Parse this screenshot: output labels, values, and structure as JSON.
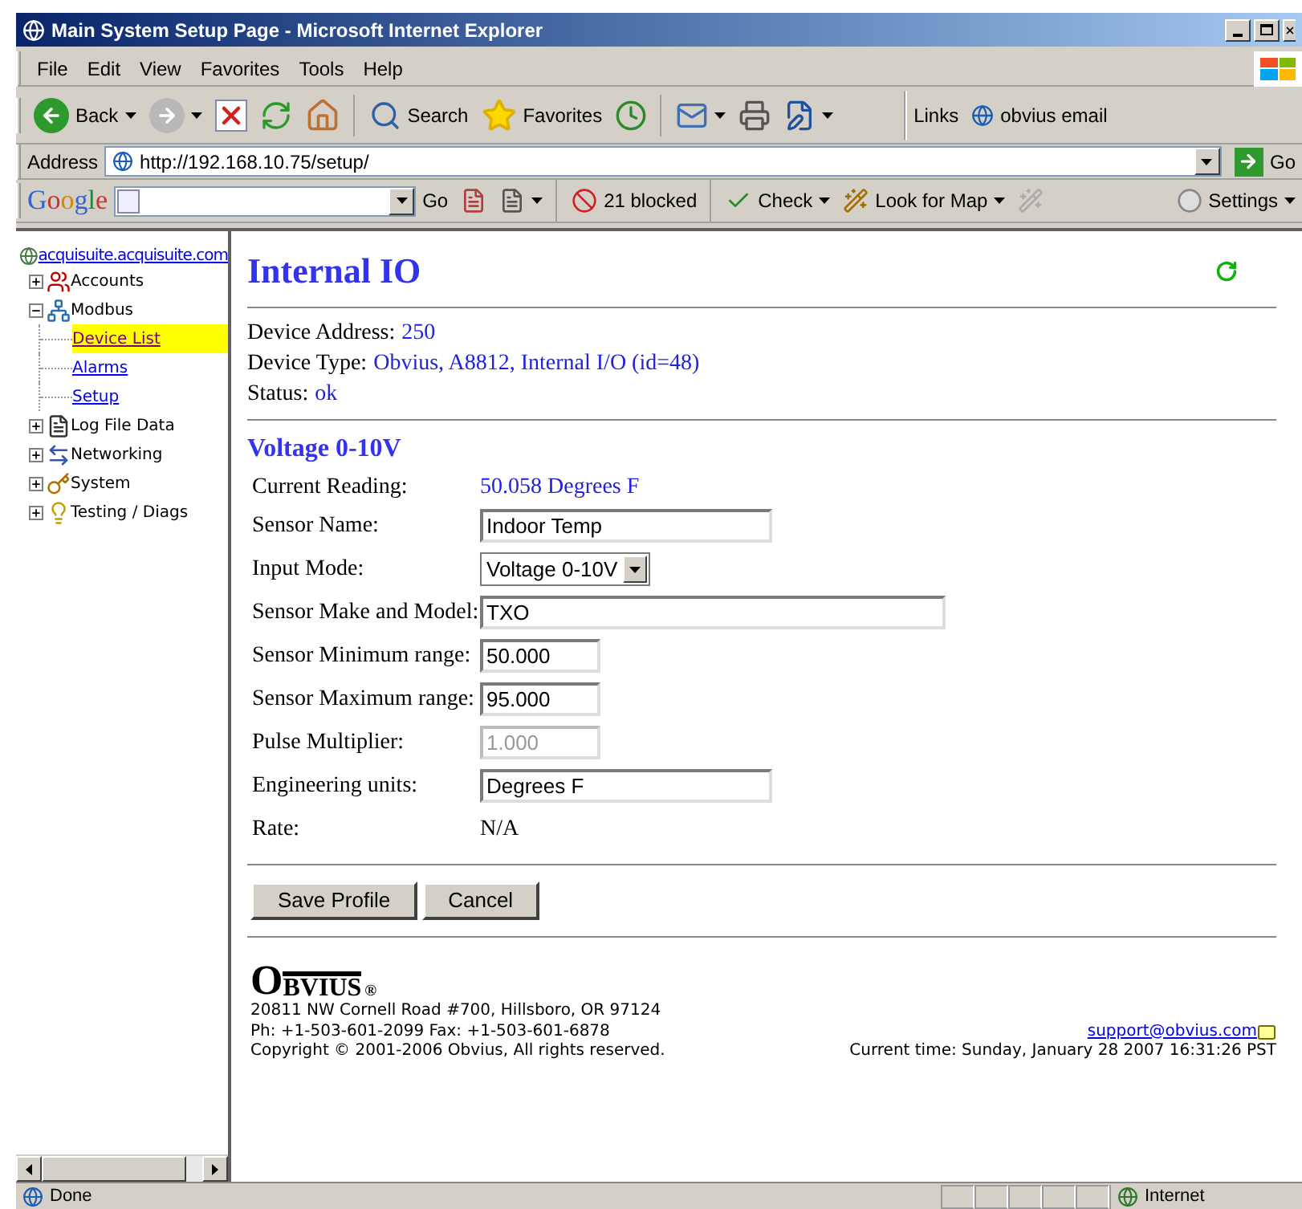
{
  "window": {
    "title": "Main System Setup Page - Microsoft Internet Explorer"
  },
  "menu": [
    "File",
    "Edit",
    "View",
    "Favorites",
    "Tools",
    "Help"
  ],
  "toolbar": {
    "back": "Back",
    "search": "Search",
    "favorites": "Favorites",
    "links": "Links",
    "link_items": [
      "obvius email"
    ]
  },
  "address": {
    "label": "Address",
    "value": "http://192.168.10.75/setup/",
    "go": "Go"
  },
  "google_bar": {
    "logo": "Google",
    "go": "Go",
    "blocked": "21 blocked",
    "check": "Check",
    "map": "Look for Map",
    "settings": "Settings"
  },
  "tree": {
    "root": "acquisuite.acquisuite.com",
    "items": [
      {
        "label": "Accounts",
        "expanded": false,
        "selected": false
      },
      {
        "label": "Modbus",
        "expanded": true,
        "selected": false,
        "children": [
          {
            "label": "Device List",
            "selected": true
          },
          {
            "label": "Alarms",
            "selected": false
          },
          {
            "label": "Setup",
            "selected": false
          }
        ]
      },
      {
        "label": "Log File Data",
        "expanded": false,
        "selected": false
      },
      {
        "label": "Networking",
        "expanded": false,
        "selected": false
      },
      {
        "label": "System",
        "expanded": false,
        "selected": false
      },
      {
        "label": "Testing / Diags",
        "expanded": false,
        "selected": false
      }
    ]
  },
  "page": {
    "title": "Internal IO",
    "device": [
      {
        "label": "Device Address:",
        "value": "250"
      },
      {
        "label": "Device Type:",
        "value": "Obvius, A8812, Internal I/O (id=48)"
      },
      {
        "label": "Status:",
        "value": "ok"
      }
    ],
    "section": "Voltage 0-10V",
    "fields": [
      {
        "kind": "reading",
        "label": "Current Reading:",
        "value": "50.058 Degrees F"
      },
      {
        "kind": "input",
        "label": "Sensor Name:",
        "value": "Indoor Temp",
        "disabled": false
      },
      {
        "kind": "select",
        "label": "Input Mode:",
        "value": "Voltage 0-10V"
      },
      {
        "kind": "input",
        "label": "Sensor Make and Model:",
        "value": "TXO",
        "disabled": false
      },
      {
        "kind": "input",
        "label": "Sensor Minimum range:",
        "value": "50.000",
        "disabled": false
      },
      {
        "kind": "input",
        "label": "Sensor Maximum range:",
        "value": "95.000",
        "disabled": false
      },
      {
        "kind": "input",
        "label": "Pulse Multiplier:",
        "value": "1.000",
        "disabled": true
      },
      {
        "kind": "input",
        "label": "Engineering units:",
        "value": "Degrees F",
        "disabled": false
      },
      {
        "kind": "text",
        "label": "Rate:",
        "value": "N/A"
      }
    ],
    "buttons": [
      "Save Profile",
      "Cancel"
    ],
    "footer": {
      "logo": "OBVIUS",
      "logo_mark": "®",
      "lines": [
        "20811 NW Cornell Road #700, Hillsboro, OR 97124",
        "Ph: +1-503-601-2099 Fax: +1-503-601-6878",
        "Copyright © 2001-2006 Obvius, All rights reserved."
      ],
      "email": "support@obvius.com",
      "time": "Current time: Sunday, January 28 2007 16:31:26 PST"
    }
  },
  "status_bar": {
    "text": "Done",
    "zone": "Internet"
  }
}
